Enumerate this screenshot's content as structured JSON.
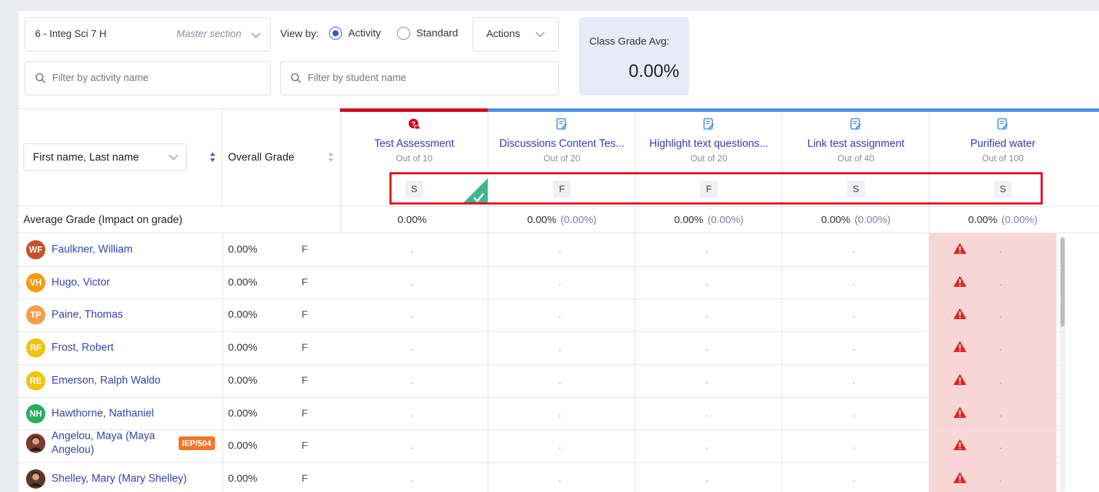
{
  "toolbar": {
    "section_name": "6 - Integ Sci 7 H",
    "section_type": "Master section",
    "view_by_label": "View by:",
    "view_activity": "Activity",
    "view_standard": "Standard",
    "actions_label": "Actions",
    "filter_activity_placeholder": "Filter by activity name",
    "filter_student_placeholder": "Filter by student name"
  },
  "class_avg": {
    "label": "Class Grade Avg:",
    "value": "0.00%"
  },
  "table": {
    "name_sort": "First name, Last name",
    "overall_header": "Overall Grade",
    "avg_row_label": "Average Grade (Impact on grade)",
    "activities": [
      {
        "title": "Test Assessment",
        "out_of": "Out of 10",
        "chip": "S",
        "avg": "0.00%",
        "impact": "",
        "accent": "#d0021b",
        "icon": "assessment-icon"
      },
      {
        "title": "Discussions Content Tes...",
        "out_of": "Out of 20",
        "chip": "F",
        "avg": "0.00%",
        "impact": "(0.00%)",
        "accent": "#4a90e2",
        "icon": "assignment-icon"
      },
      {
        "title": "Highlight text questions...",
        "out_of": "Out of 20",
        "chip": "F",
        "avg": "0.00%",
        "impact": "(0.00%)",
        "accent": "#4a90e2",
        "icon": "assignment-icon"
      },
      {
        "title": "Link test assignment",
        "out_of": "Out of 40",
        "chip": "S",
        "avg": "0.00%",
        "impact": "(0.00%)",
        "accent": "#4a90e2",
        "icon": "assignment-icon"
      },
      {
        "title": "Purified water",
        "out_of": "Out of 100",
        "chip": "S",
        "avg": "0.00%",
        "impact": "(0.00%)",
        "accent": "#4a90e2",
        "icon": "assignment-icon"
      }
    ],
    "students": [
      {
        "initials": "WF",
        "name": "Faulkner, William",
        "grade": "0.00%",
        "letter": "F",
        "color": "#c8502a"
      },
      {
        "initials": "VH",
        "name": "Hugo, Victor",
        "grade": "0.00%",
        "letter": "F",
        "color": "#f39c12"
      },
      {
        "initials": "TP",
        "name": "Paine, Thomas",
        "grade": "0.00%",
        "letter": "F",
        "color": "#f0a04a"
      },
      {
        "initials": "RF",
        "name": "Frost, Robert",
        "grade": "0.00%",
        "letter": "F",
        "color": "#f1c40f"
      },
      {
        "initials": "RE",
        "name": "Emerson, Ralph Waldo",
        "grade": "0.00%",
        "letter": "F",
        "color": "#f1c40f"
      },
      {
        "initials": "NH",
        "name": "Hawthorne, Nathaniel",
        "grade": "0.00%",
        "letter": "F",
        "color": "#27ae60"
      },
      {
        "initials": "",
        "name_line1": "Angelou, Maya (Maya",
        "name_line2": "Angelou)",
        "badge": "IEP/504",
        "grade": "0.00%",
        "letter": "F",
        "color": "#7a3b2e"
      },
      {
        "initials": "",
        "name": "Shelley, Mary (Mary Shelley)",
        "grade": "0.00%",
        "letter": "F",
        "color": "#5a3a2e"
      }
    ],
    "empty_cell": "."
  },
  "colors": {
    "link": "#3443b0",
    "warning_bg": "#f9d6d6",
    "warning_icon": "#e02424",
    "highlight_box": "#e1001a",
    "class_avg_bg": "#e8ebf7"
  }
}
